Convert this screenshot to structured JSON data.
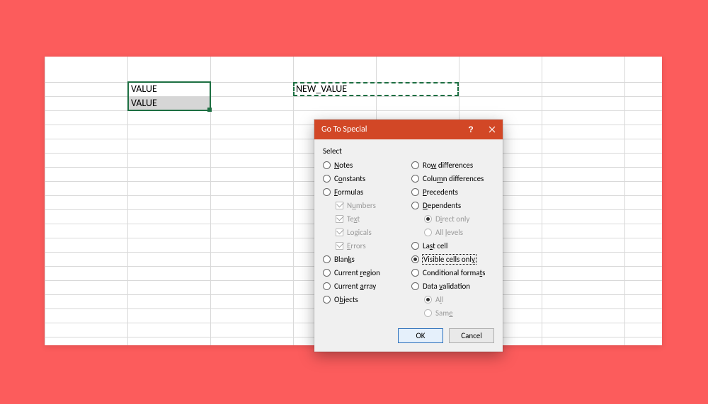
{
  "colors": {
    "page_bg": "#fc5c5c",
    "titlebar": "#d24726",
    "selection": "#1d6f42"
  },
  "spreadsheet": {
    "cell_a1": "VALUE",
    "cell_a2": "VALUE",
    "cell_c1": "NEW_VALUE",
    "selection": {
      "range": "A1:A2",
      "active": "A1"
    },
    "copy_range": "C1:D1"
  },
  "dialog": {
    "title": "Go To Special",
    "section_label": "Select",
    "left": {
      "notes": "Notes",
      "constants": "Constants",
      "formulas": "Formulas",
      "numbers": "Numbers",
      "text": "Text",
      "logicals": "Logicals",
      "errors": "Errors",
      "blanks": "Blanks",
      "current_region": "Current region",
      "current_array": "Current array",
      "objects": "Objects"
    },
    "right": {
      "row_diff": "Row differences",
      "col_diff": "Column differences",
      "precedents": "Precedents",
      "dependents": "Dependents",
      "direct_only": "Direct only",
      "all_levels": "All levels",
      "last_cell": "Last cell",
      "visible_cells": "Visible cells only",
      "cond_formats": "Conditional formats",
      "data_validation": "Data validation",
      "all": "All",
      "same": "Same"
    },
    "selected_option": "visible_cells",
    "buttons": {
      "ok": "OK",
      "cancel": "Cancel"
    }
  }
}
